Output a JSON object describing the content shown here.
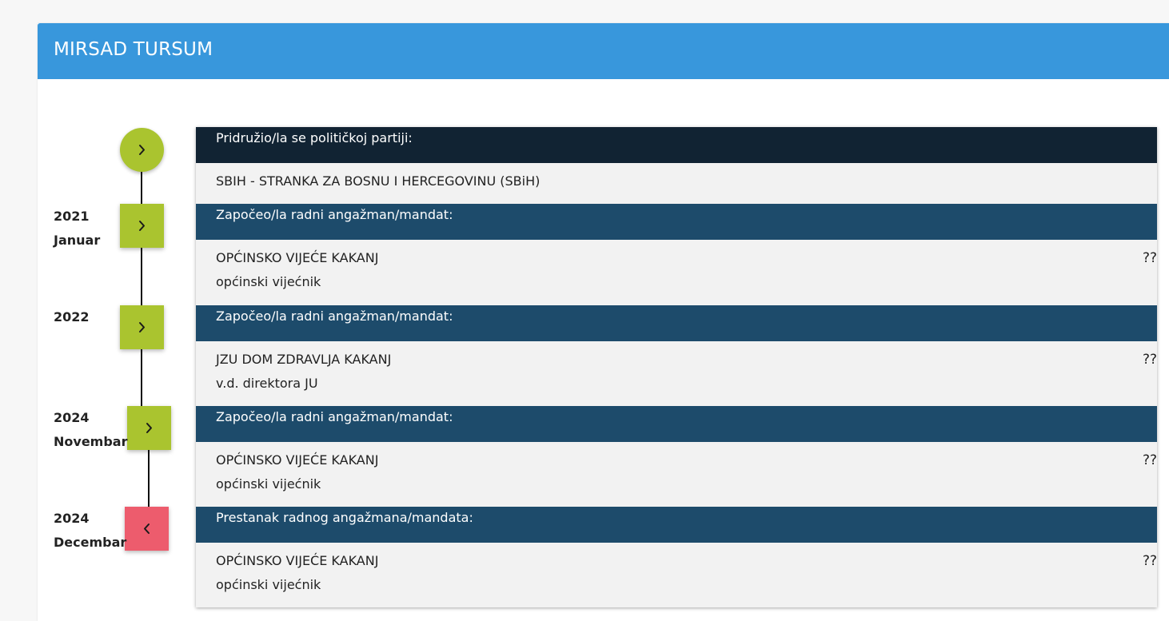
{
  "header": {
    "title": "MIRSAD TURSUM"
  },
  "colors": {
    "header_bg": "#3897dc",
    "marker_green": "#aac42f",
    "marker_red": "#ed5c6d",
    "head_dark": "#112333",
    "head_blue": "#1d4b6b",
    "body_bg": "#f2f2f2"
  },
  "timeline": [
    {
      "date_year": "",
      "date_detail": "",
      "marker_icon": "chevron-right-icon",
      "marker_color": "#aac42f",
      "heading": "Pridružio/la se političkoj partiji:",
      "heading_color": "#112333",
      "line1": "SBIH - STRANKA ZA BOSNU I HERCEGOVINU (SBiH)",
      "line2": "",
      "extra": ""
    },
    {
      "date_year": "2021",
      "date_detail": "Januar",
      "marker_icon": "chevron-right-icon",
      "marker_color": "#aac42f",
      "heading": "Započeo/la radni angažman/mandat:",
      "heading_color": "#1d4b6b",
      "line1": "OPĆINSKO VIJEĆE KAKANJ",
      "line2": "općinski vijećnik",
      "extra": "??"
    },
    {
      "date_year": "2022",
      "date_detail": "",
      "marker_icon": "chevron-right-icon",
      "marker_color": "#aac42f",
      "heading": "Započeo/la radni angažman/mandat:",
      "heading_color": "#1d4b6b",
      "line1": "JZU DOM ZDRAVLJA KAKANJ",
      "line2": "v.d. direktora JU",
      "extra": "??"
    },
    {
      "date_year": "2024",
      "date_detail": "Novembar",
      "marker_icon": "chevron-right-icon",
      "marker_color": "#aac42f",
      "heading": "Započeo/la radni angažman/mandat:",
      "heading_color": "#1d4b6b",
      "line1": "OPĆINSKO VIJEĆE KAKANJ",
      "line2": "općinski vijećnik",
      "extra": "??"
    },
    {
      "date_year": "2024",
      "date_detail": "Decembar",
      "marker_icon": "chevron-left-icon",
      "marker_color": "#ed5c6d",
      "heading": "Prestanak radnog angažmana/mandata:",
      "heading_color": "#1d4b6b",
      "line1": "OPĆINSKO VIJEĆE KAKANJ",
      "line2": "općinski vijećnik",
      "extra": "??"
    }
  ]
}
